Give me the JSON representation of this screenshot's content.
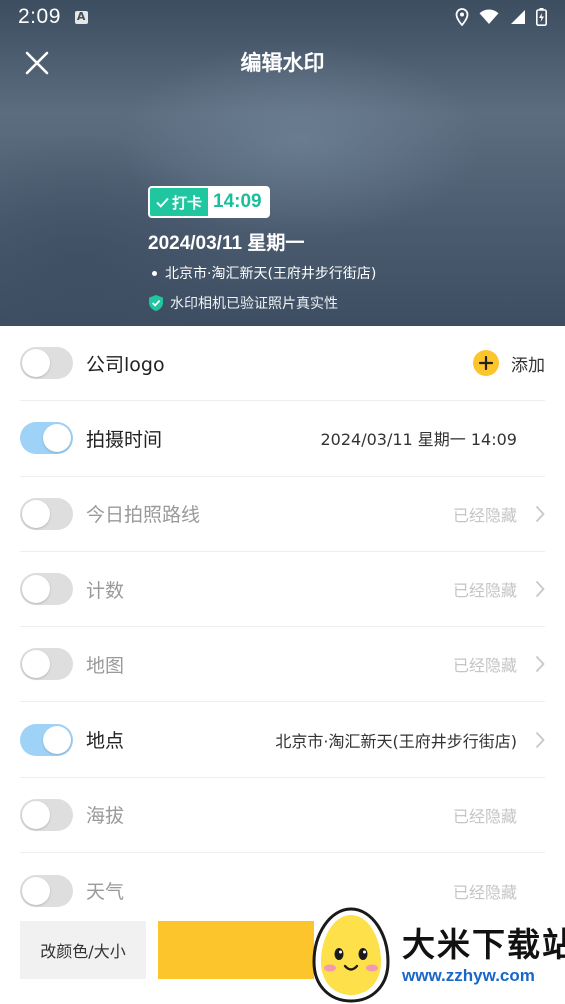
{
  "status_bar": {
    "time": "2:09"
  },
  "header": {
    "title": "编辑水印"
  },
  "watermark": {
    "tag": "打卡",
    "time": "14:09",
    "date": "2024/03/11 星期一",
    "location": "北京市·淘汇新天(王府井步行街店)",
    "verify": "水印相机已验证照片真实性"
  },
  "settings": [
    {
      "label": "公司logo",
      "on": false,
      "value": "",
      "action": "添加"
    },
    {
      "label": "拍摄时间",
      "on": true,
      "value": "2024/03/11 星期一 14:09"
    },
    {
      "label": "今日拍照路线",
      "on": false,
      "value": "已经隐藏"
    },
    {
      "label": "计数",
      "on": false,
      "value": "已经隐藏"
    },
    {
      "label": "地图",
      "on": false,
      "value": "已经隐藏"
    },
    {
      "label": "地点",
      "on": true,
      "value": "北京市·淘汇新天(王府井步行街店)"
    },
    {
      "label": "海拔",
      "on": false,
      "value": "已经隐藏"
    },
    {
      "label": "天气",
      "on": false,
      "value": "已经隐藏"
    }
  ],
  "bottom": {
    "color_size_label": "改颜色/大小",
    "confirm_label": ""
  },
  "overlay_logo": {
    "name": "大米下载站",
    "url": "www.zzhyw.com"
  },
  "colors": {
    "accent_yellow": "#fdc52c",
    "toggle_on": "#9fd2f7",
    "toggle_off": "#dedede",
    "badge_green": "#1fc6a0"
  }
}
